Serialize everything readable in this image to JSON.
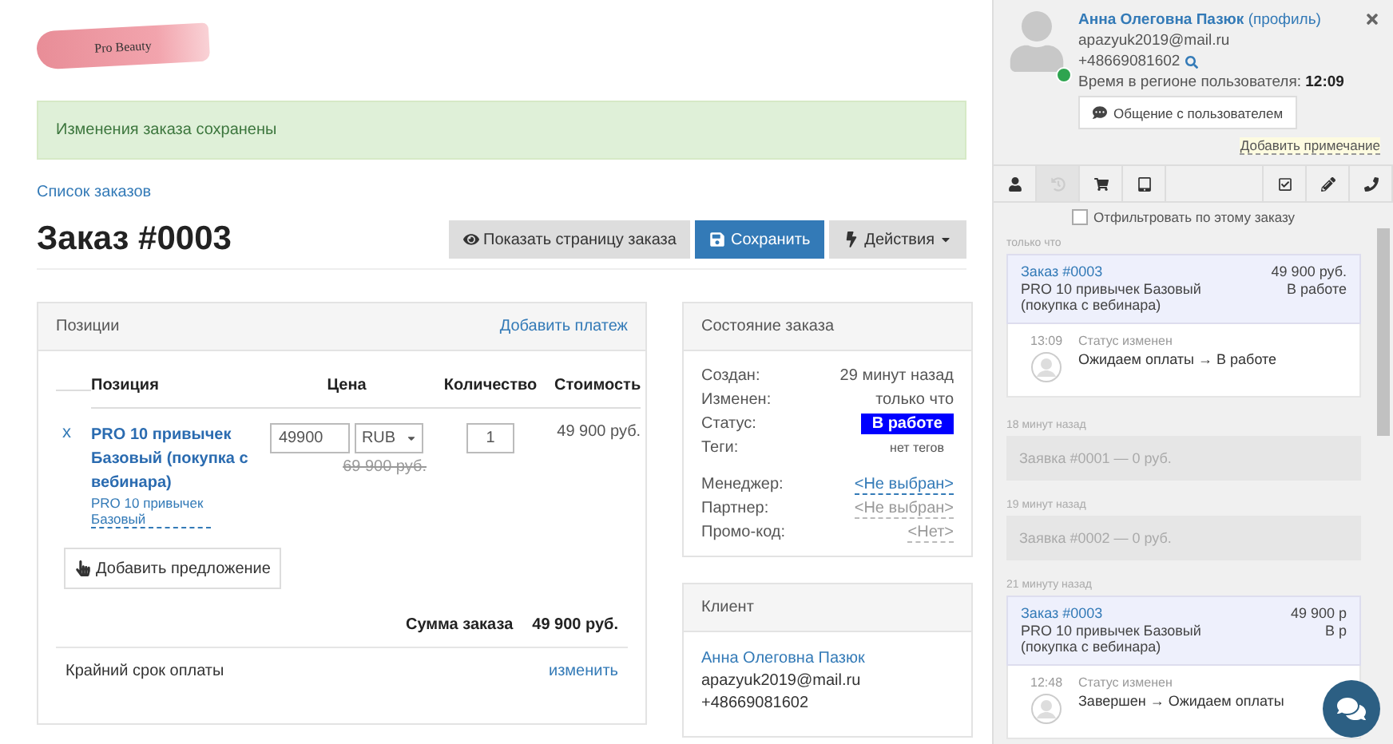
{
  "logo": {
    "text": "Pro Beauty"
  },
  "alert": "Изменения заказа сохранены",
  "breadcrumb": "Список заказов",
  "title": "Заказ #0003",
  "actions": [
    {
      "kind": "view",
      "label": "Показать страницу заказа"
    },
    {
      "kind": "save",
      "label": "Сохранить"
    },
    {
      "kind": "menu",
      "label": "Действия"
    }
  ],
  "positions": {
    "title": "Позиции",
    "add_payment": "Добавить платеж",
    "columns": [
      "Позиция",
      "Цена",
      "Количество",
      "Стоимость"
    ],
    "items": [
      {
        "remove": "x",
        "name": "PRO 10 привычек Базовый (покупка с вебинара)",
        "offer": "PRO 10 привычек Базовый",
        "price": "49900",
        "currency": "RUB",
        "old_price": "69 900 руб.",
        "quantity": "1",
        "cost": "49 900 руб."
      }
    ],
    "add_offer": "Добавить предложение",
    "total_label": "Сумма заказа",
    "total": "49 900 руб.",
    "deadline_label": "Крайний срок оплаты",
    "deadline_action": "изменить"
  },
  "status_panel": {
    "title": "Состояние заказа",
    "groups": [
      [
        {
          "label": "Создан:",
          "value": "29 минут назад",
          "kind": "text"
        },
        {
          "label": "Изменен:",
          "value": "только что",
          "kind": "text"
        },
        {
          "label": "Статус:",
          "value": "В работе",
          "kind": "badge"
        },
        {
          "label": "Теги:",
          "value": "нет тегов",
          "kind": "small"
        }
      ],
      [
        {
          "label": "Менеджер:",
          "value": "<Не выбран>",
          "kind": "link"
        },
        {
          "label": "Партнер:",
          "value": "<Не выбран>",
          "kind": "muted"
        },
        {
          "label": "Промо-код:",
          "value": "<Нет>",
          "kind": "muted"
        }
      ]
    ]
  },
  "client": {
    "title": "Клиент",
    "name": "Анна Олеговна Пазюк",
    "email": "apazyuk2019@mail.ru",
    "phone": "+48669081602"
  },
  "user": {
    "name": "Анна Олеговна Пазюк",
    "profile_link": "(профиль)",
    "email": "apazyuk2019@mail.ru",
    "phone": "+48669081602",
    "time_label": "Время в регионе пользователя:",
    "time": "12:09",
    "chat_button": "Общение с пользователем",
    "add_note": "Добавить примечание",
    "online": true
  },
  "user_tabs": [
    {
      "selected": false
    },
    {
      "selected": true
    },
    {
      "selected": false
    },
    {
      "selected": false
    },
    {
      "selected": false
    },
    {
      "selected": false
    },
    {
      "selected": false
    }
  ],
  "filter": {
    "label": "Отфильтровать по этому заказу",
    "checked": false
  },
  "feed": [
    {
      "when": "только что",
      "kind": "order",
      "title": "Заказ #0003",
      "amount": "49 900 руб.",
      "product": "PRO 10 привычек Базовый (покупка с вебинара)",
      "status": "В работе",
      "event": {
        "time": "13:09",
        "label": "Статус изменен",
        "text": "Ожидаем оплаты → В работе"
      }
    },
    {
      "when": "18 минут назад",
      "kind": "request",
      "title": "Заявка #0001 — 0 руб."
    },
    {
      "when": "19 минут назад",
      "kind": "request",
      "title": "Заявка #0002 — 0 руб."
    },
    {
      "when": "21 минуту назад",
      "kind": "order",
      "title": "Заказ #0003",
      "amount": "49 900 р",
      "product": "PRO 10 привычек Базовый (покупка с вебинара)",
      "status": "В р",
      "event": {
        "time": "12:48",
        "label": "Статус изменен",
        "text": "Завершен → Ожидаем оплаты"
      }
    }
  ]
}
